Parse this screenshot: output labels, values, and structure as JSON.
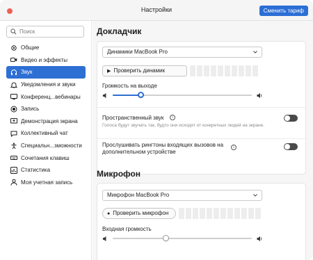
{
  "window": {
    "title": "Настройки",
    "upgrade_button": "Сменить тариф"
  },
  "sidebar": {
    "search_placeholder": "Поиск",
    "items": [
      {
        "label": "Общие",
        "icon": "gear-icon",
        "active": false
      },
      {
        "label": "Видео и эффекты",
        "icon": "video-icon",
        "active": false
      },
      {
        "label": "Звук",
        "icon": "headphones-icon",
        "active": true
      },
      {
        "label": "Уведомления и звуки",
        "icon": "bell-icon",
        "active": false
      },
      {
        "label": "Конференц...вебинары",
        "icon": "conference-icon",
        "active": false
      },
      {
        "label": "Запись",
        "icon": "record-icon",
        "active": false
      },
      {
        "label": "Демонстрация экрана",
        "icon": "share-screen-icon",
        "active": false
      },
      {
        "label": "Коллективный чат",
        "icon": "chat-icon",
        "active": false
      },
      {
        "label": "Специальн...зможности",
        "icon": "accessibility-icon",
        "active": false
      },
      {
        "label": "Сочетания клавиш",
        "icon": "keyboard-icon",
        "active": false
      },
      {
        "label": "Статистика",
        "icon": "statistics-icon",
        "active": false
      },
      {
        "label": "Моя учетная запись",
        "icon": "account-icon",
        "active": false
      }
    ]
  },
  "speaker": {
    "section_title": "Докладчик",
    "device": "Динамики MacBook Pro",
    "test_button": "Проверить динамик",
    "volume_label": "Громкость на выходе",
    "volume_fraction": 0.2,
    "spatial_label": "Пространственный звук",
    "spatial_desc": "Голоса будут звучать так, будто они исходят от конкретных людей на экране.",
    "spatial_on": false,
    "ringtone_label": "Прослушивать рингтоны входящих вызовов на дополнительном устройстве",
    "ringtone_on": false
  },
  "microphone": {
    "section_title": "Микрофон",
    "device": "Микрофон MacBook Pro",
    "test_button": "Проверить микрофон",
    "volume_label": "Входная громкость",
    "volume_fraction": 0.38
  },
  "colors": {
    "accent": "#2e6fd4",
    "close": "#ee5f57",
    "toggle_off": "#4a4a4a"
  }
}
